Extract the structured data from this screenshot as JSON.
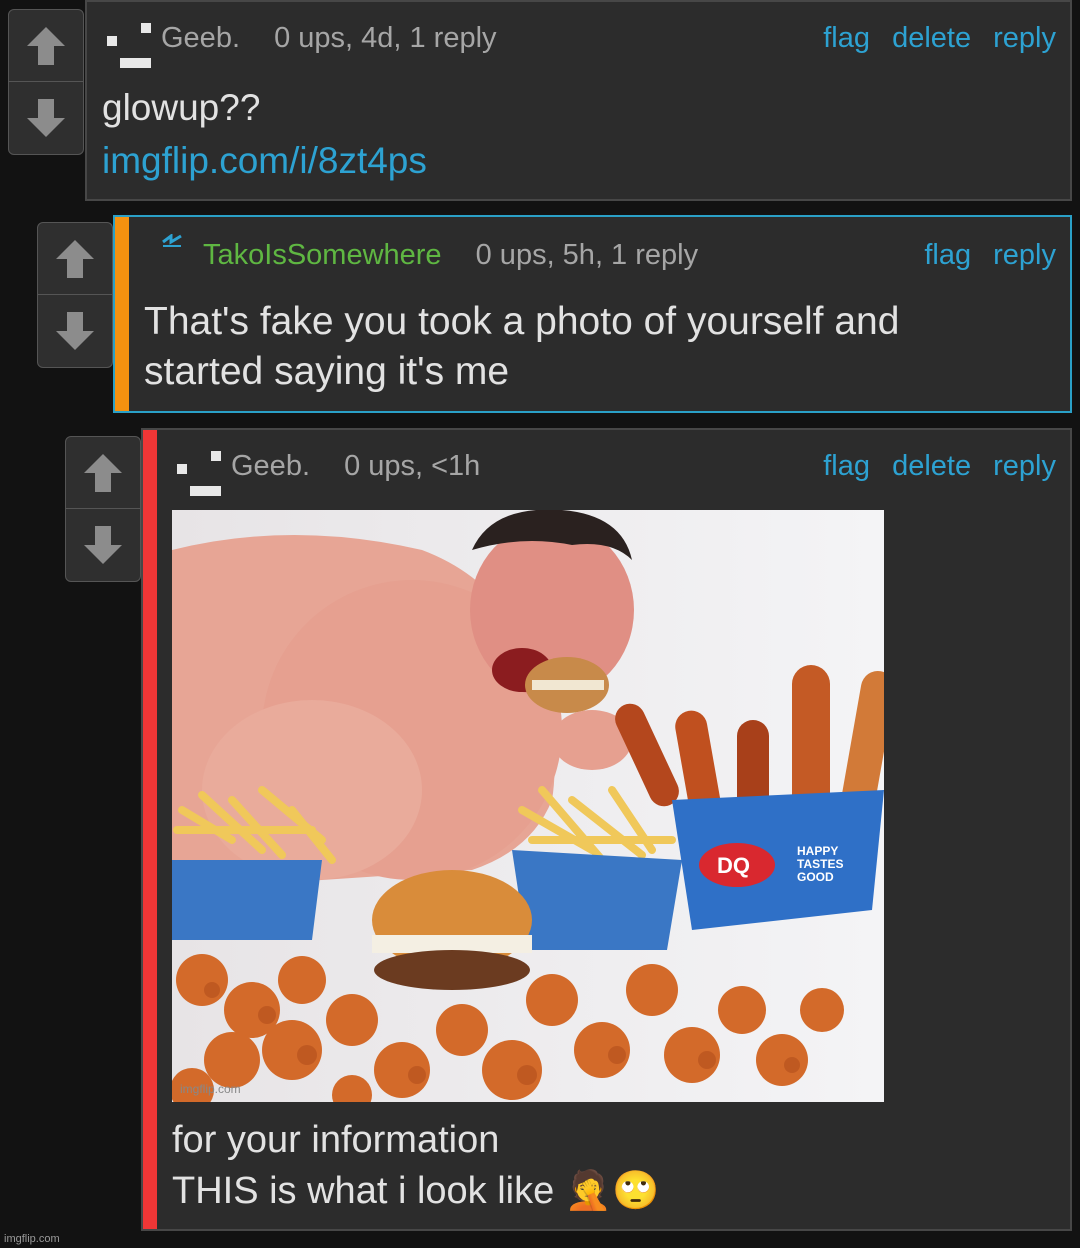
{
  "comments": [
    {
      "username": "Geeb.",
      "stats": "0 ups, 4d, 1 reply",
      "actions": [
        "flag",
        "delete",
        "reply"
      ],
      "text": "glowup??",
      "link": "imgflip.com/i/8zt4ps"
    },
    {
      "username": "TakoIsSomewhere",
      "stats": "0 ups, 5h, 1 reply",
      "actions": [
        "flag",
        "reply"
      ],
      "text_line1": "That's fake you took a photo of yourself and",
      "text_line2": "started saying it's me",
      "stripe_color": "#f5910f",
      "username_color": "#5fb742"
    },
    {
      "username": "Geeb.",
      "stats": "0 ups, <1h",
      "actions": [
        "flag",
        "delete",
        "reply"
      ],
      "image_watermark": "imgflip.com",
      "image_packaging": [
        "DQ",
        "HAPPY",
        "TASTES",
        "GOOD"
      ],
      "text_line1": "for your information",
      "text_line2": "THIS is what i look like 🤦🙄",
      "stripe_color": "#ef3636"
    }
  ],
  "icons": {
    "upvote": "arrow-up-icon",
    "downvote": "arrow-down-icon"
  },
  "colors": {
    "link": "#2da2d2",
    "highlight_border": "#2aa0c7",
    "background": "#121212",
    "card": "#2c2c2c"
  },
  "footer": {
    "watermark": "imgflip.com"
  }
}
